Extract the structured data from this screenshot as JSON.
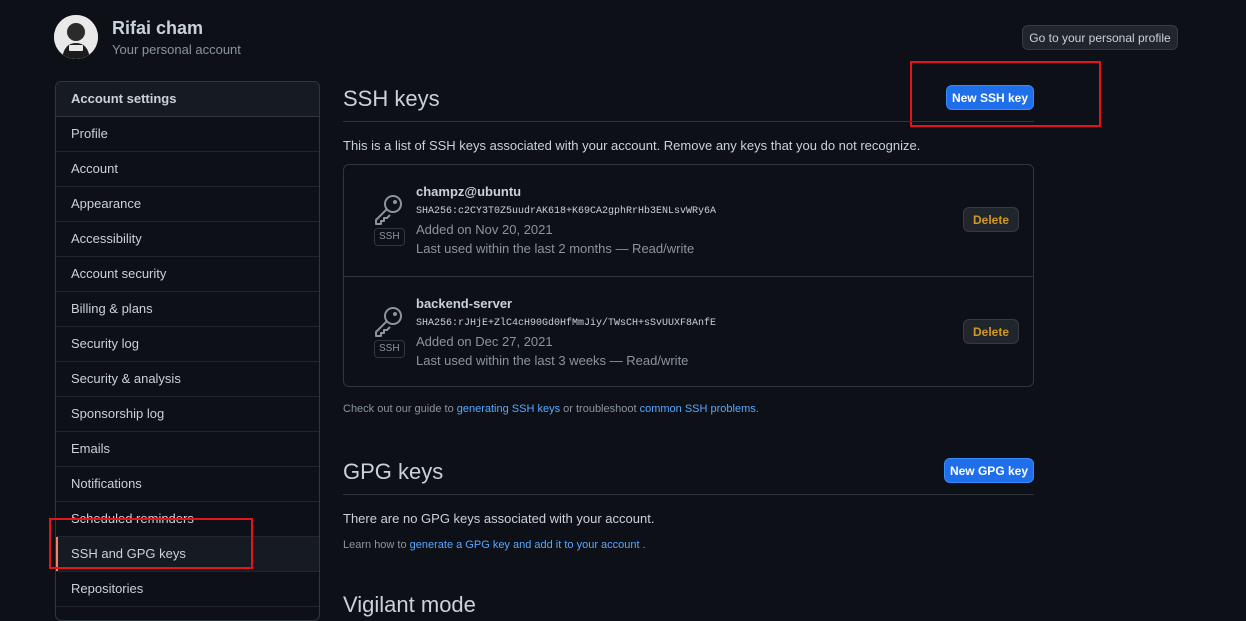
{
  "user": {
    "name": "Rifai cham",
    "subtitle": "Your personal account",
    "profile_button": "Go to your personal profile"
  },
  "sidebar": {
    "heading": "Account settings",
    "items": [
      {
        "label": "Profile"
      },
      {
        "label": "Account"
      },
      {
        "label": "Appearance"
      },
      {
        "label": "Accessibility"
      },
      {
        "label": "Account security"
      },
      {
        "label": "Billing & plans"
      },
      {
        "label": "Security log"
      },
      {
        "label": "Security & analysis"
      },
      {
        "label": "Sponsorship log"
      },
      {
        "label": "Emails"
      },
      {
        "label": "Notifications"
      },
      {
        "label": "Scheduled reminders"
      },
      {
        "label": "SSH and GPG keys",
        "active": true
      },
      {
        "label": "Repositories"
      }
    ]
  },
  "ssh": {
    "title": "SSH keys",
    "new_button": "New SSH key",
    "description": "This is a list of SSH keys associated with your account. Remove any keys that you do not recognize.",
    "keys": [
      {
        "title": "champz@ubuntu",
        "fingerprint": "SHA256:c2CY3T0Z5uudrAK618+K69CA2gphRrHb3ENLsvWRy6A",
        "added": "Added on Nov 20, 2021",
        "last_used": "Last used within the last 2 months — Read/write",
        "badge": "SSH",
        "delete_label": "Delete"
      },
      {
        "title": "backend-server",
        "fingerprint": "SHA256:rJHjE+ZlC4cH90Gd0HfMmJiy/TWsCH+sSvUUXF8AnfE",
        "added": "Added on Dec 27, 2021",
        "last_used": "Last used within the last 3 weeks — Read/write",
        "badge": "SSH",
        "delete_label": "Delete"
      }
    ],
    "guide_prefix": "Check out our guide to ",
    "guide_link": "generating SSH keys",
    "guide_middle": " or troubleshoot ",
    "guide_link2": "common SSH problems",
    "guide_suffix": "."
  },
  "gpg": {
    "title": "GPG keys",
    "new_button": "New GPG key",
    "empty": "There are no GPG keys associated with your account.",
    "learn_prefix": "Learn how to ",
    "learn_link": "generate a GPG key and add it to your account",
    "learn_suffix": " ."
  },
  "vigilant": {
    "title": "Vigilant mode"
  },
  "colors": {
    "background": "#0d1117",
    "accent": "#1f6feb",
    "link": "#58a6ff",
    "danger_text": "#d29922",
    "highlight": "#e5141a",
    "active_marker": "#f78166"
  }
}
